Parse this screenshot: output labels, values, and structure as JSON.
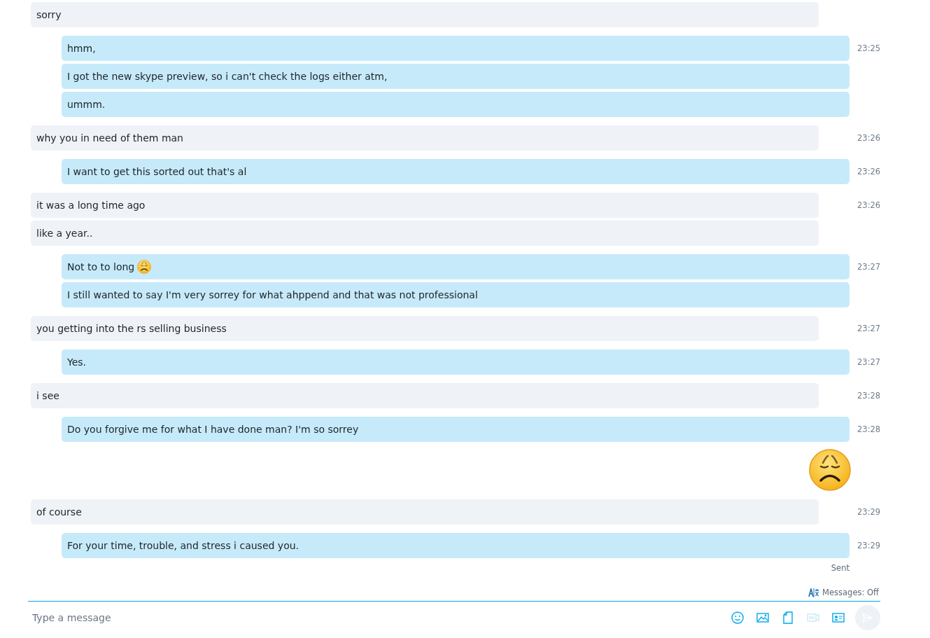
{
  "groups": [
    {
      "kind": "in",
      "messages": [
        {
          "kind": "text",
          "text": "sorry"
        }
      ]
    },
    {
      "kind": "out",
      "time": "23:25",
      "messages": [
        {
          "kind": "text",
          "text": "hmm,"
        },
        {
          "kind": "text",
          "text": "I got the new skype preview, so i can't check the logs either atm,"
        },
        {
          "kind": "text",
          "text": "ummm."
        }
      ]
    },
    {
      "kind": "in",
      "time": "23:26",
      "messages": [
        {
          "kind": "text",
          "text": "why you in need of them man"
        }
      ]
    },
    {
      "kind": "out",
      "time": "23:26",
      "messages": [
        {
          "kind": "text",
          "text": "I want to get this sorted out that's al"
        }
      ]
    },
    {
      "kind": "in",
      "time": "23:26",
      "messages": [
        {
          "kind": "text",
          "text": "it was a long time ago"
        },
        {
          "kind": "text",
          "text": "like a year.."
        }
      ]
    },
    {
      "kind": "out",
      "time": "23:27",
      "messages": [
        {
          "kind": "text-emoji",
          "text": "Not to to long"
        },
        {
          "kind": "text",
          "text": "I still wanted to say I'm very sorrey for what ahppend and that was not professional"
        }
      ]
    },
    {
      "kind": "in",
      "time": "23:27",
      "messages": [
        {
          "kind": "text",
          "text": "you getting into the rs selling business"
        }
      ]
    },
    {
      "kind": "out",
      "time": "23:27",
      "messages": [
        {
          "kind": "text",
          "text": "Yes."
        }
      ]
    },
    {
      "kind": "in",
      "time": "23:28",
      "messages": [
        {
          "kind": "text",
          "text": "i see"
        }
      ]
    },
    {
      "kind": "out",
      "time": "23:28",
      "messages": [
        {
          "kind": "text",
          "text": "Do you forgive me for what I have done man? I'm so sorrey"
        }
      ]
    },
    {
      "kind": "out",
      "messages": [
        {
          "kind": "emoji"
        }
      ]
    },
    {
      "kind": "in",
      "time": "23:29",
      "messages": [
        {
          "kind": "text",
          "text": "of course"
        }
      ]
    },
    {
      "kind": "out",
      "time": "23:29",
      "messages": [
        {
          "kind": "text",
          "text": "For your time, trouble, and stress i caused you."
        }
      ]
    }
  ],
  "status": "Sent",
  "translator": {
    "label": "Messages: Off"
  },
  "composer": {
    "placeholder": "Type a message",
    "video_message_disabled": true,
    "send_disabled": true
  }
}
